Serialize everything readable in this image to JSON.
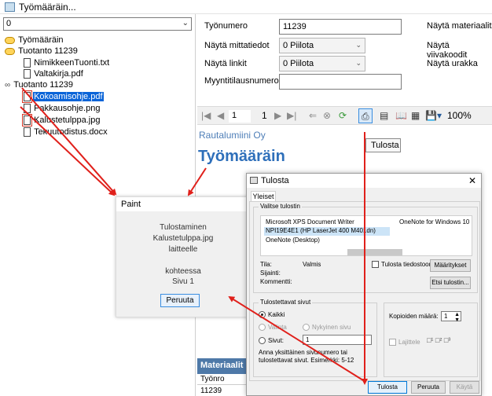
{
  "window": {
    "title": "Työmääräin..."
  },
  "left": {
    "combo_value": "0",
    "tree": [
      {
        "label": "Työmääräin",
        "icon": "folder-icon",
        "indent": 0
      },
      {
        "label": "Tuotanto 11239",
        "icon": "folder-icon",
        "indent": 0
      },
      {
        "label": "NimikkeenTuonti.txt",
        "icon": "document-icon",
        "indent": 1
      },
      {
        "label": "Valtakirja.pdf",
        "icon": "document-icon",
        "indent": 1
      },
      {
        "label": "Tuotanto 11239",
        "icon": "link-icon",
        "indent": 0
      },
      {
        "label": "Kokoamisohje.pdf",
        "icon": "document-icon",
        "indent": 1,
        "selected": true
      },
      {
        "label": "Pakkausohje.png",
        "icon": "document-icon",
        "indent": 1
      },
      {
        "label": "Kalustetulppa.jpg",
        "icon": "document-icon",
        "indent": 1
      },
      {
        "label": "Tekuutodistus.docx",
        "icon": "document-icon",
        "indent": 1
      }
    ]
  },
  "form": {
    "tyonumero_label": "Työnumero",
    "tyonumero_value": "11239",
    "mittatiedot_label": "Näytä mittatiedot",
    "mittatiedot_value": "0 Piilota",
    "linkit_label": "Näytä linkit",
    "linkit_value": "0 Piilota",
    "myyntitilaus_label": "Myyntitilausnumero",
    "myyntitilaus_value": "",
    "nayta_materiaalit": "Näytä materiaalit",
    "nayta_viivakoodit": "Näytä viivakoodit",
    "nayta_urakka": "Näytä urakka"
  },
  "toolbar": {
    "page_current": "1",
    "page_total": "1",
    "zoom": "100%",
    "tooltip": "Tulosta"
  },
  "report": {
    "company": "Rautalumiini Oy",
    "title": "Työmääräin",
    "materials_header": "Materiaalit",
    "materials_col1": "Työnro",
    "materials_cell": "11239"
  },
  "paint": {
    "title": "Paint",
    "line1": "Tulostaminen",
    "line2": "Kalustetulppa.jpg",
    "line3": "laitteelle",
    "line4": "kohteessa",
    "line5": "Sivu 1",
    "cancel": "Peruuta"
  },
  "print": {
    "title": "Tulosta",
    "tab": "Yleiset",
    "select_printer_label": "Valitse tulostin",
    "printers": [
      "Microsoft XPS Document Writer",
      "NPI19E4E1 (HP LaserJet 400 M401dn)",
      "OneNote (Desktop)",
      "OneNote for Windows 10"
    ],
    "status_label": "Tila:",
    "status_value": "Valmis",
    "location_label": "Sijainti:",
    "comment_label": "Kommentti:",
    "print_to_file": "Tulosta tiedostoon",
    "preferences": "Määritykset",
    "find_printer": "Etsi tulostin...",
    "page_range_label": "Tulostettavat sivut",
    "all": "Kaikki",
    "selection": "Valinta",
    "current_page": "Nykyinen sivu",
    "pages": "Sivut:",
    "pages_value": "1",
    "hint": "Anna yksittäinen sivunumero tai tulostettavat sivut. Esimerkki: 5-12",
    "copies_label": "Kopioiden määrä:",
    "copies_value": "1",
    "collate": "Lajittele",
    "btn_print": "Tulosta",
    "btn_cancel": "Peruuta",
    "btn_apply": "Käytä"
  },
  "colors": {
    "accent": "#0a64d8",
    "report_title": "#2e6fba",
    "arrow": "#e0201b",
    "mat_header": "#4e79a8"
  }
}
